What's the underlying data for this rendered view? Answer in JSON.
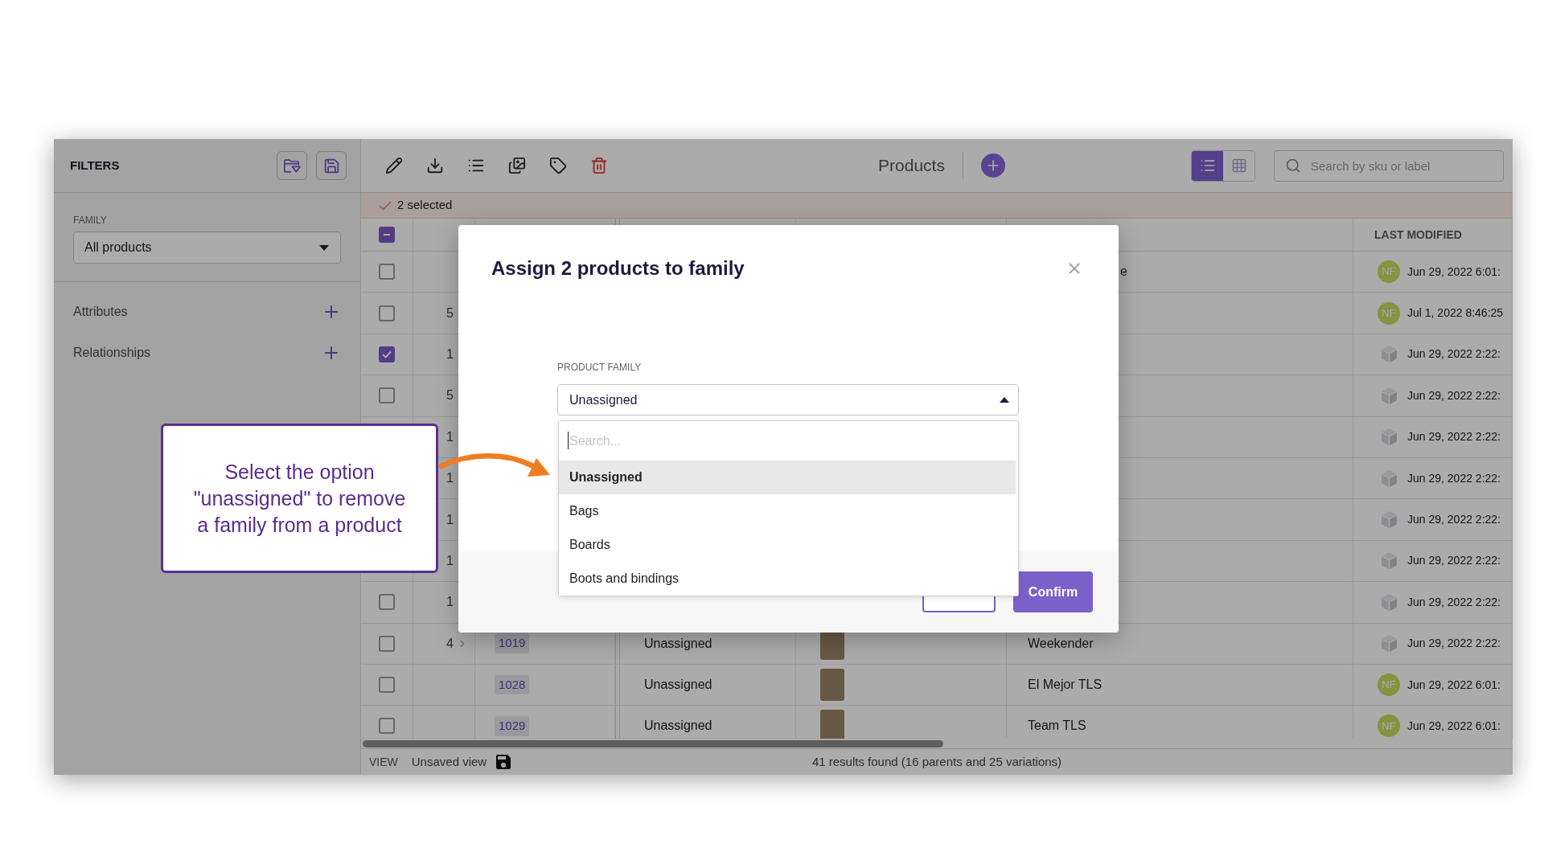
{
  "sidebar": {
    "title": "FILTERS",
    "family": {
      "label": "FAMILY",
      "value": "All products",
      "expanded": false
    },
    "sections": [
      {
        "label": "Attributes"
      },
      {
        "label": "Relationships"
      }
    ]
  },
  "toolbar": {
    "title": "Products",
    "view_modes": [
      {
        "kind": "list",
        "selected": true
      },
      {
        "kind": "grid",
        "selected": false
      }
    ],
    "search": {
      "placeholder": "Search by sku or label"
    }
  },
  "selection_bar": {
    "text": "2 selected"
  },
  "table": {
    "select_all": {
      "indeterminate": true
    },
    "last_modified_header": "LAST MODIFIED",
    "rows": [
      {
        "selected": false,
        "name": "e",
        "name_cut": true,
        "modified": {
          "kind": "user",
          "initials": "NF",
          "date": "Jun 29, 2022 6:01:"
        }
      },
      {
        "selected": false,
        "count": "5",
        "modified": {
          "kind": "user",
          "initials": "NF",
          "date": "Jul 1, 2022 8:46:25"
        }
      },
      {
        "selected": true,
        "count": "1",
        "modified": {
          "kind": "system",
          "date": "Jun 29, 2022 2:22:"
        }
      },
      {
        "selected": false,
        "count": "5",
        "modified": {
          "kind": "system",
          "date": "Jun 29, 2022 2:22:"
        }
      },
      {
        "count": "1",
        "modified": {
          "kind": "system",
          "date": "Jun 29, 2022 2:22:"
        }
      },
      {
        "count": "1",
        "modified": {
          "kind": "system",
          "date": "Jun 29, 2022 2:22:"
        }
      },
      {
        "count": "1",
        "modified": {
          "kind": "system",
          "date": "Jun 29, 2022 2:22:"
        }
      },
      {
        "count": "1",
        "modified": {
          "kind": "system",
          "date": "Jun 29, 2022 2:22:"
        }
      },
      {
        "selected": false,
        "count": "1",
        "modified": {
          "kind": "system",
          "date": "Jun 29, 2022 2:22:"
        }
      },
      {
        "selected": false,
        "count": "4",
        "expandable": true,
        "id": "1019",
        "family": "Unassigned",
        "photo": true,
        "name": "Weekender",
        "modified": {
          "kind": "system",
          "date": "Jun 29, 2022 2:22:"
        }
      },
      {
        "selected": false,
        "id": "1028",
        "family": "Unassigned",
        "photo": true,
        "name": "El Mejor TLS",
        "modified": {
          "kind": "user",
          "initials": "NF",
          "date": "Jun 29, 2022 6:01:"
        }
      },
      {
        "selected": false,
        "id": "1029",
        "family": "Unassigned",
        "photo": true,
        "name": "Team TLS",
        "modified": {
          "kind": "user",
          "initials": "NF",
          "date": "Jun 29, 2022 6:01:"
        }
      }
    ]
  },
  "footer": {
    "view_label": "VIEW",
    "view_name": "Unsaved view",
    "results": "41 results found (16 parents and 25 variations)"
  },
  "modal": {
    "title": "Assign 2 products to family",
    "field": {
      "label": "PRODUCT FAMILY",
      "value": "Unassigned",
      "expanded": true
    },
    "dropdown": {
      "placeholder": "Search...",
      "options": [
        {
          "label": "Unassigned",
          "selected": true
        },
        {
          "label": "Bags",
          "selected": false
        },
        {
          "label": "Boards",
          "selected": false
        },
        {
          "label": "Boots and bindings",
          "selected": false
        }
      ]
    },
    "buttons": [
      {
        "kind": "outlined"
      },
      {
        "kind": "primary",
        "label": "Confirm"
      }
    ]
  },
  "callout": {
    "text": "Select the option \"unassigned\" to remove a family from a product"
  }
}
